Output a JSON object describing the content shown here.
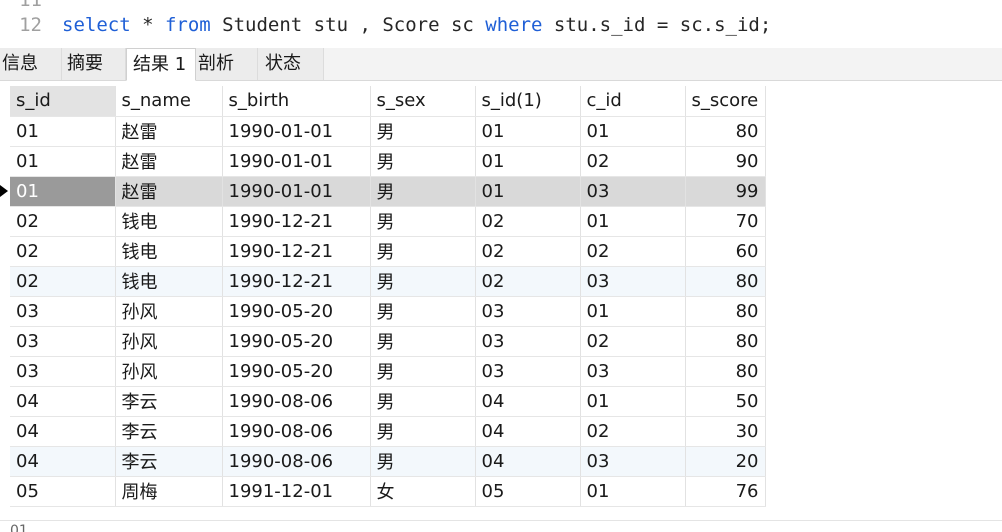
{
  "editor": {
    "line11_no": "11",
    "line12_no": "12",
    "kw_select": "select",
    "text_star": " * ",
    "kw_from": "from",
    "text_tables": " Student stu , Score sc ",
    "kw_where": "where",
    "text_cond": " stu.s_id = sc.s_id;"
  },
  "tabs": [
    "信息",
    "摘要",
    "结果 1",
    "剖析",
    "状态"
  ],
  "table": {
    "columns": [
      "s_id",
      "s_name",
      "s_birth",
      "s_sex",
      "s_id(1)",
      "c_id",
      "s_score"
    ],
    "rows": [
      [
        "01",
        "赵雷",
        "1990-01-01",
        "男",
        "01",
        "01",
        "80"
      ],
      [
        "01",
        "赵雷",
        "1990-01-01",
        "男",
        "01",
        "02",
        "90"
      ],
      [
        "01",
        "赵雷",
        "1990-01-01",
        "男",
        "01",
        "03",
        "99"
      ],
      [
        "02",
        "钱电",
        "1990-12-21",
        "男",
        "02",
        "01",
        "70"
      ],
      [
        "02",
        "钱电",
        "1990-12-21",
        "男",
        "02",
        "02",
        "60"
      ],
      [
        "02",
        "钱电",
        "1990-12-21",
        "男",
        "02",
        "03",
        "80"
      ],
      [
        "03",
        "孙风",
        "1990-05-20",
        "男",
        "03",
        "01",
        "80"
      ],
      [
        "03",
        "孙风",
        "1990-05-20",
        "男",
        "03",
        "02",
        "80"
      ],
      [
        "03",
        "孙风",
        "1990-05-20",
        "男",
        "03",
        "03",
        "80"
      ],
      [
        "04",
        "李云",
        "1990-08-06",
        "男",
        "04",
        "01",
        "50"
      ],
      [
        "04",
        "李云",
        "1990-08-06",
        "男",
        "04",
        "02",
        "30"
      ],
      [
        "04",
        "李云",
        "1990-08-06",
        "男",
        "04",
        "03",
        "20"
      ],
      [
        "05",
        "周梅",
        "1991-12-01",
        "女",
        "05",
        "01",
        "76"
      ]
    ]
  },
  "bottom": {
    "partial_text": "01"
  }
}
